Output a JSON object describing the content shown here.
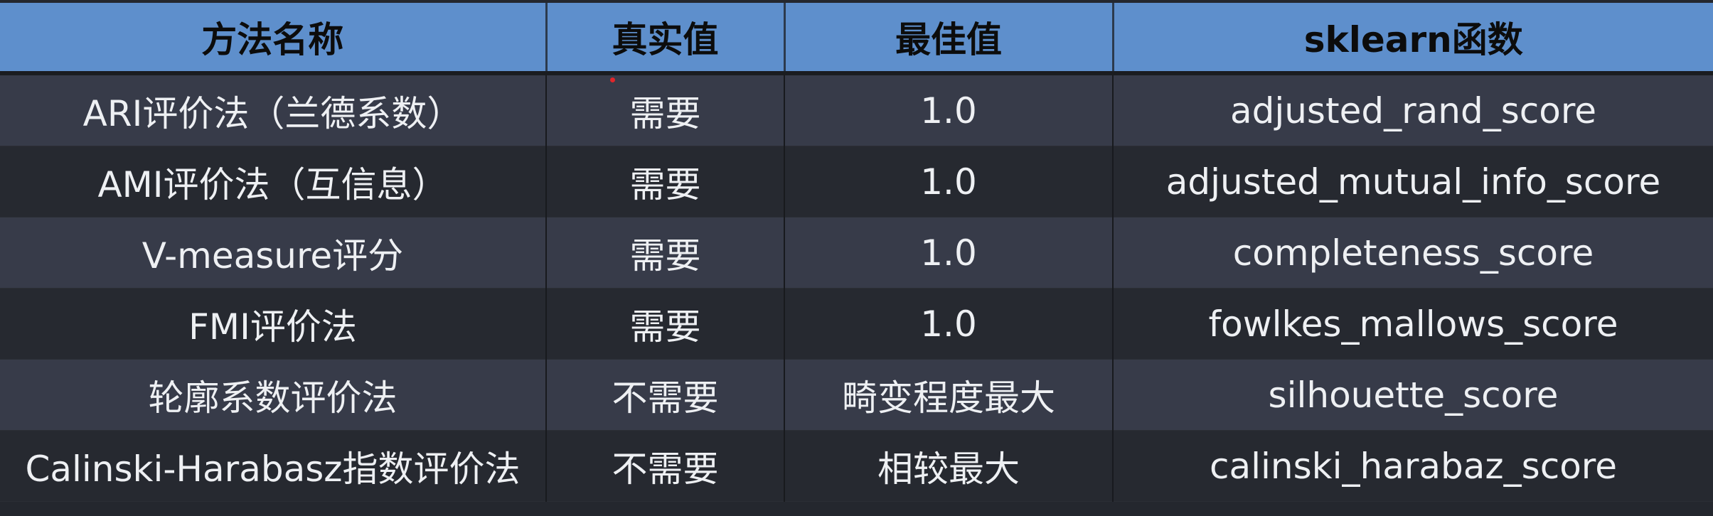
{
  "table": {
    "headers": [
      "方法名称",
      "真实值",
      "最佳值",
      "sklearn函数"
    ],
    "rows": [
      [
        "ARI评价法（兰德系数）",
        "需要",
        "1.0",
        "adjusted_rand_score"
      ],
      [
        "AMI评价法（互信息）",
        "需要",
        "1.0",
        "adjusted_mutual_info_score"
      ],
      [
        "V-measure评分",
        "需要",
        "1.0",
        "completeness_score"
      ],
      [
        "FMI评价法",
        "需要",
        "1.0",
        "fowlkes_mallows_score"
      ],
      [
        "轮廓系数评价法",
        "不需要",
        "畸变程度最大",
        "silhouette_score"
      ],
      [
        "Calinski-Harabasz指数评价法",
        "不需要",
        "相较最大",
        "calinski_harabaz_score"
      ]
    ]
  },
  "colors": {
    "header_bg": "#5e8fcc",
    "row_light": "#373b49",
    "row_dark": "#262930",
    "text": "#eef0f3",
    "marker": "#e0262b"
  }
}
